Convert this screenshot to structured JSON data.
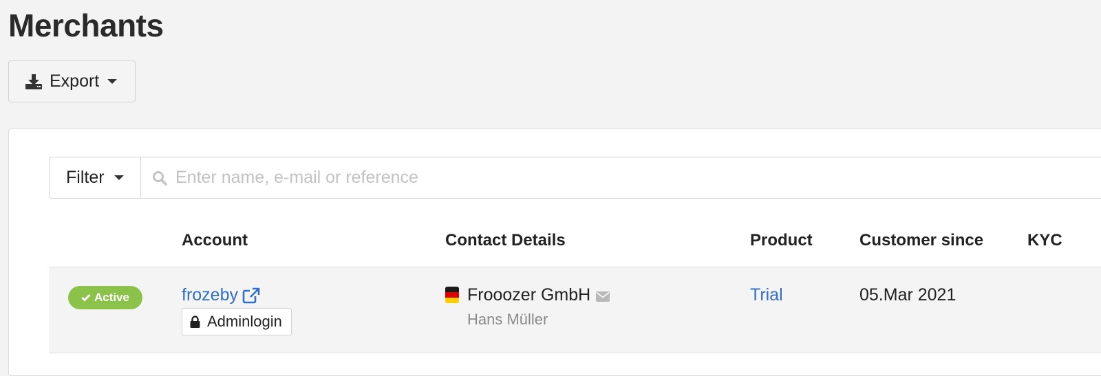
{
  "page": {
    "title": "Merchants"
  },
  "toolbar": {
    "export_label": "Export",
    "export_icon": "download-icon"
  },
  "filter": {
    "button_label": "Filter",
    "search_placeholder": "Enter name, e-mail or reference",
    "search_value": "",
    "search_icon": "search-icon"
  },
  "table": {
    "columns": {
      "account": "Account",
      "contact": "Contact Details",
      "product": "Product",
      "since": "Customer since",
      "kyc": "KYC"
    },
    "rows": [
      {
        "status": "Active",
        "status_color": "#8bc34a",
        "account": "frozeby",
        "adminlogin_label": "Adminlogin",
        "country_flag": "germany-flag",
        "company": "Frooozer GmbH",
        "contact_name": "Hans Müller",
        "product": "Trial",
        "customer_since": "05.Mar 2021",
        "kyc": ""
      }
    ]
  },
  "colors": {
    "link": "#2f6fc6",
    "active_badge": "#8bc34a",
    "background": "#f3f3f3"
  }
}
